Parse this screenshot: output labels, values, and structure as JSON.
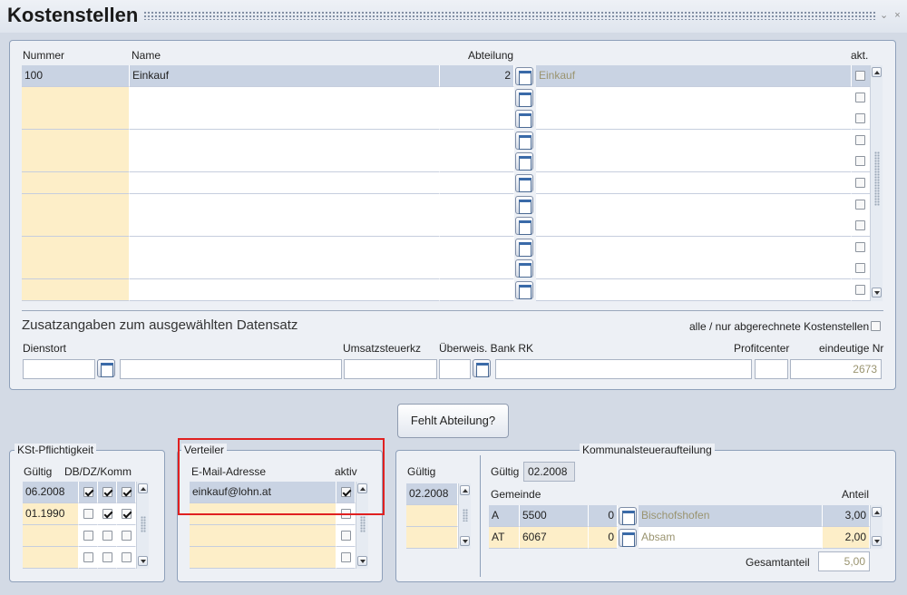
{
  "window": {
    "title": "Kostenstellen",
    "controls": "⌄ ×"
  },
  "grid": {
    "headers": {
      "nummer": "Nummer",
      "name": "Name",
      "abteilung": "Abteilung",
      "akt": "akt."
    },
    "rows": [
      {
        "nummer": "100",
        "name": "Einkauf",
        "abteilung": "2",
        "abteilung_name": "Einkauf",
        "akt": false
      },
      {
        "nummer": "",
        "name": "",
        "abteilung": "",
        "abteilung_name": "",
        "akt": false
      },
      {
        "nummer": "",
        "name": "",
        "abteilung": "",
        "abteilung_name": "",
        "akt": false
      },
      {
        "nummer": "",
        "name": "",
        "abteilung": "",
        "abteilung_name": "",
        "akt": false
      },
      {
        "nummer": "",
        "name": "",
        "abteilung": "",
        "abteilung_name": "",
        "akt": false
      },
      {
        "nummer": "",
        "name": "",
        "abteilung": "",
        "abteilung_name": "",
        "akt": false
      },
      {
        "nummer": "",
        "name": "",
        "abteilung": "",
        "abteilung_name": "",
        "akt": false
      },
      {
        "nummer": "",
        "name": "",
        "abteilung": "",
        "abteilung_name": "",
        "akt": false
      },
      {
        "nummer": "",
        "name": "",
        "abteilung": "",
        "abteilung_name": "",
        "akt": false
      },
      {
        "nummer": "",
        "name": "",
        "abteilung": "",
        "abteilung_name": "",
        "akt": false
      },
      {
        "nummer": "",
        "name": "",
        "abteilung": "",
        "abteilung_name": "",
        "akt": false
      }
    ]
  },
  "zusatz": {
    "heading": "Zusatzangaben zum ausgewählten Datensatz",
    "filter_label": "alle / nur abgerechnete Kostenstellen",
    "filter_checked": false,
    "labels": {
      "dienstort": "Dienstort",
      "umsatzsteuerkz": "Umsatzsteuerkz",
      "ueberweis": "Überweis. Bank RK",
      "profitcenter": "Profitcenter",
      "eindeutige_nr": "eindeutige Nr"
    },
    "values": {
      "dienstort": "",
      "dienstort_name": "",
      "umsatzsteuerkz": "",
      "ueberweis": "",
      "ueberweis_name": "",
      "profitcenter": "",
      "eindeutige_nr": "2673"
    }
  },
  "fehlt_button": "Fehlt Abteilung?",
  "kst": {
    "title": "KSt-Pflichtigkeit",
    "headers": {
      "gueltig": "Gültig",
      "cols": "DB/DZ/Komm"
    },
    "rows": [
      {
        "gueltig": "06.2008",
        "db": true,
        "dz": true,
        "komm": true
      },
      {
        "gueltig": "01.1990",
        "db": false,
        "dz": true,
        "komm": true
      },
      {
        "gueltig": "",
        "db": false,
        "dz": false,
        "komm": false
      },
      {
        "gueltig": "",
        "db": false,
        "dz": false,
        "komm": false
      }
    ]
  },
  "verteiler": {
    "title": "Verteiler",
    "headers": {
      "email": "E-Mail-Adresse",
      "aktiv": "aktiv"
    },
    "rows": [
      {
        "email": "einkauf@lohn.at",
        "aktiv": true
      },
      {
        "email": "",
        "aktiv": false
      },
      {
        "email": "",
        "aktiv": false
      },
      {
        "email": "",
        "aktiv": false
      }
    ],
    "highlight_color": "#e02020"
  },
  "kommunal": {
    "title": "Kommunalsteueraufteilung",
    "gueltig_label": "Gültig",
    "gueltig_list": [
      "02.2008",
      "",
      ""
    ],
    "gueltig_selected_label": "Gültig",
    "gueltig_selected": "02.2008",
    "headers": {
      "gemeinde": "Gemeinde",
      "anteil": "Anteil"
    },
    "rows": [
      {
        "code": "A",
        "nr": "5500",
        "flag": "0",
        "name": "Bischofshofen",
        "anteil": "3,00"
      },
      {
        "code": "AT",
        "nr": "6067",
        "flag": "0",
        "name": "Absam",
        "anteil": "2,00"
      }
    ],
    "gesamt_label": "Gesamtanteil",
    "gesamt_value": "5,00"
  }
}
